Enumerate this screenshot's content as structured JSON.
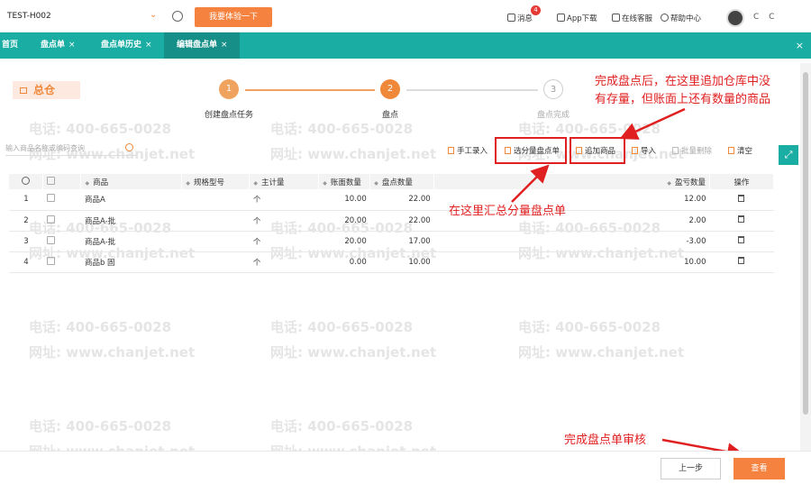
{
  "topbar": {
    "org": "TEST-H002",
    "trial_button": "我要体验一下",
    "msg_badge": "4",
    "messages": "消息",
    "app_download": "App下载",
    "online_service": "在线客服",
    "help": "帮助中心",
    "user": "C C"
  },
  "tabs": [
    {
      "label": "首页"
    },
    {
      "label": "盘点单",
      "close": "×"
    },
    {
      "label": "盘点单历史",
      "close": "×"
    },
    {
      "label": "编辑盘点单",
      "close": "×"
    }
  ],
  "tab_close_all": "×",
  "warehouse": "总仓",
  "steps": [
    {
      "num": "1",
      "label": "创建盘点任务"
    },
    {
      "num": "2",
      "label": "盘点"
    },
    {
      "num": "3",
      "label": "盘点完成"
    }
  ],
  "search": {
    "placeholder": "输入商品名称或编码查询"
  },
  "actions": {
    "manual": "手工录入",
    "select_sub": "选分量盘点单",
    "add_goods": "追加商品",
    "import": "导入",
    "batch_delete": "批量删除",
    "clear": "清空"
  },
  "table": {
    "headers": {
      "product": "商品",
      "spec": "规格型号",
      "unit": "主计量",
      "book_qty": "账面数量",
      "count_qty": "盘点数量",
      "diff_qty": "盈亏数量",
      "op": "操作"
    },
    "rows": [
      {
        "no": "1",
        "product": "商品A",
        "unit": "个",
        "book": "10.00",
        "count": "22.00",
        "diff": "12.00"
      },
      {
        "no": "2",
        "product": "商品A-批",
        "unit": "个",
        "book": "20.00",
        "count": "22.00",
        "diff": "2.00"
      },
      {
        "no": "3",
        "product": "商品A-批",
        "unit": "个",
        "book": "20.00",
        "count": "17.00",
        "diff": "-3.00"
      },
      {
        "no": "4",
        "product": "商品b 固",
        "unit": "个",
        "book": "0.00",
        "count": "10.00",
        "diff": "10.00"
      }
    ]
  },
  "annotations": {
    "top_line1": "完成盘点后，在这里追加仓库中没",
    "top_line2": "有存量，但账面上还有数量的商品",
    "middle": "在这里汇总分量盘点单",
    "bottom": "完成盘点单审核"
  },
  "watermark": {
    "phone": "电话: 400-665-0028",
    "site": "网址: www.chanjet.net"
  },
  "footer": {
    "prev": "上一步",
    "view": "查看"
  },
  "colors": {
    "teal": "#1aada4",
    "orange": "#f5823f",
    "red": "#e02020"
  }
}
